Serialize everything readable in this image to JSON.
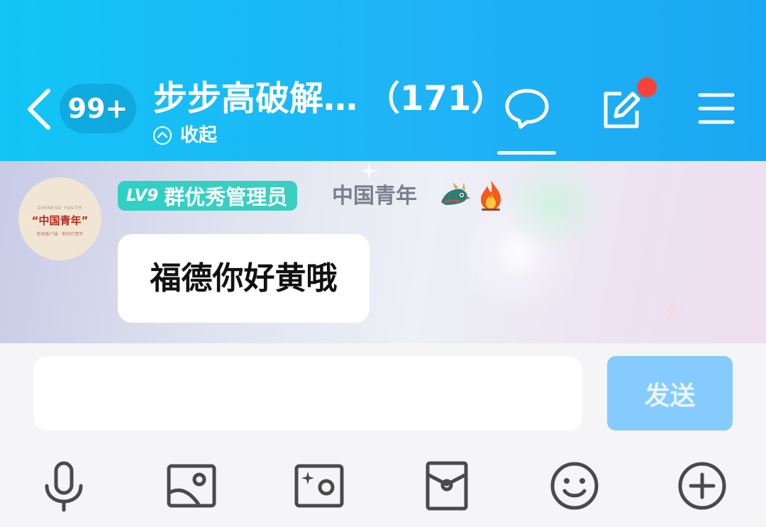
{
  "header": {
    "unread_badge": "99+",
    "group_title": "步步高破解…",
    "member_count": "（171）",
    "collapse_label": "收起",
    "has_notification": true
  },
  "message": {
    "avatar_text": {
      "top": "CHINESE YOUTH",
      "main": "“中国青年”",
      "sub": "新闻客户端 · 新时代青年"
    },
    "level": "LV9",
    "role": "群优秀管理员",
    "sender": "中国青年",
    "text": "福德你好黄哦"
  },
  "input": {
    "value": "",
    "send_label": "发送"
  },
  "toolbar": {
    "icons": [
      "microphone-icon",
      "image-icon",
      "camera-icon",
      "red-packet-icon",
      "emoji-icon",
      "plus-icon"
    ]
  },
  "colors": {
    "header_start": "#12c5f6",
    "header_end": "#1aa8f2",
    "badge_teal": "#2fd0c4",
    "send_button": "#85cbfd",
    "notification_dot": "#f5433b",
    "icon_gray": "#4a4a4a"
  }
}
